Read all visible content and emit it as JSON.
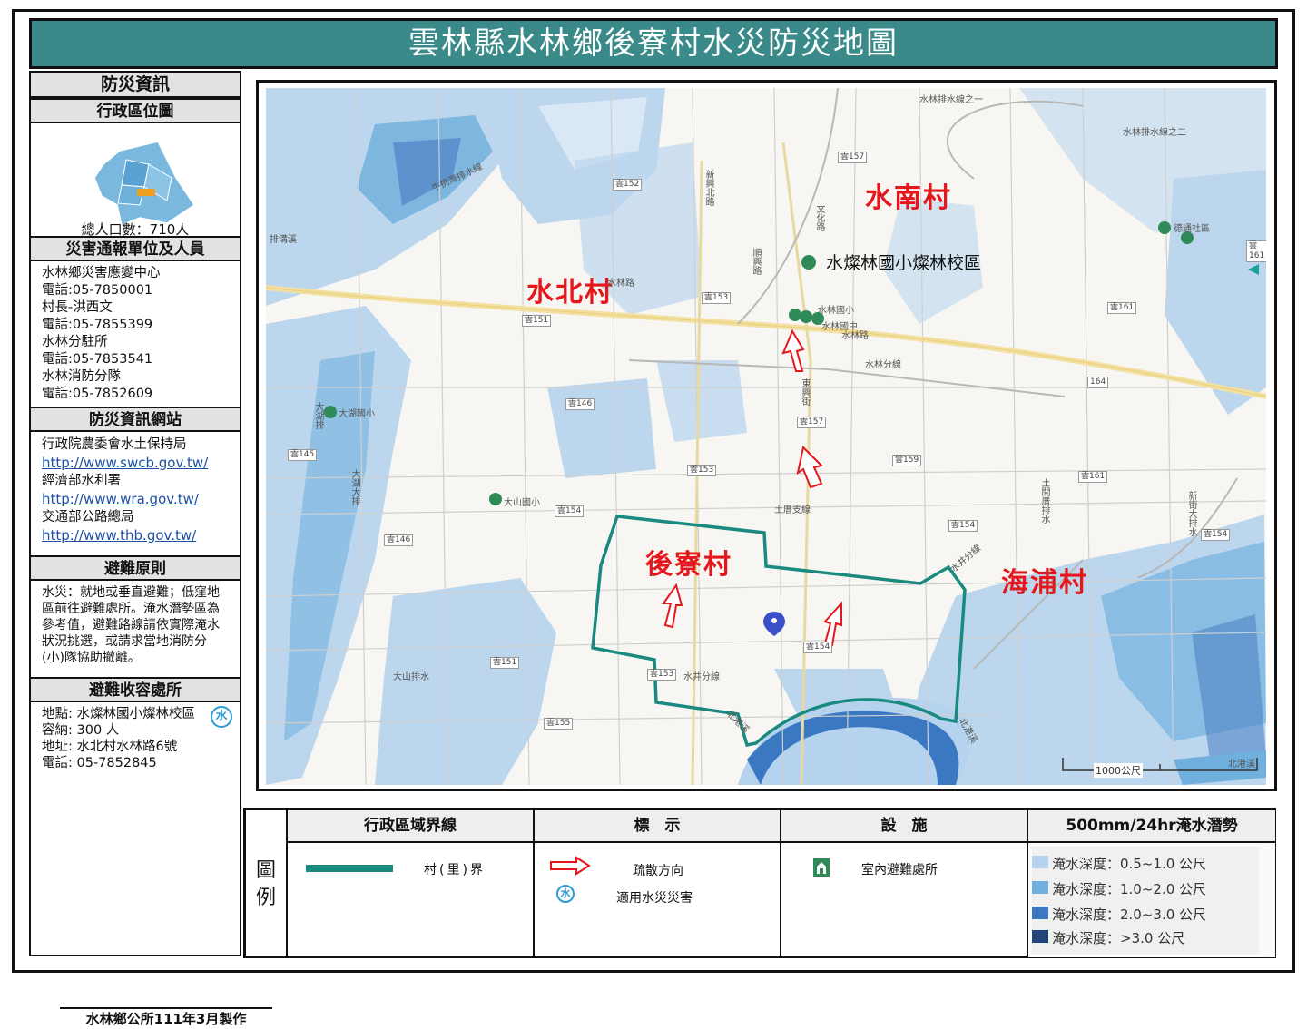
{
  "title": "雲林縣水林鄉後寮村水災防災地圖",
  "sidebar": {
    "info_header": "防災資訊",
    "location_header": "行政區位圖",
    "population": "總人口數：710人",
    "contacts_header": "災害通報單位及人員",
    "contacts": [
      "水林鄉災害應變中心",
      "電話:05-7850001",
      "村長-洪西文",
      "電話:05-7855399",
      "水林分駐所",
      "電話:05-7853541",
      "水林消防分隊",
      "電話:05-7852609"
    ],
    "websites_header": "防災資訊網站",
    "sites": [
      {
        "name": "行政院農委會水土保持局",
        "url": "http://www.swcb.gov.tw/"
      },
      {
        "name": "經濟部水利署",
        "url": "http://www.wra.gov.tw/"
      },
      {
        "name": "交通部公路總局",
        "url": "http://www.thb.gov.tw/"
      }
    ],
    "principle_header": "避難原則",
    "principle_text": "水災：就地或垂直避難；低窪地區前往避難處所。淹水潛勢區為參考值，避難路線請依實際淹水狀況挑選，或請求當地消防分(小)隊協助撤離。",
    "shelter_header": "避難收容處所",
    "shelter": {
      "location": "地點: 水燦林國小燦林校區",
      "capacity": "容納: 300 人",
      "address": "地址: 水北村水林路6號",
      "phone": "電話: 05-7852845",
      "badge": "水"
    },
    "footer": "水林鄉公所111年3月製作"
  },
  "map": {
    "villages": [
      "水南村",
      "水北村",
      "後寮村",
      "海浦村"
    ],
    "school_label": "水燦林國小燦林校區",
    "scale_label": "1000公尺",
    "roads": [
      "雲157",
      "雲152",
      "雲153",
      "雲151",
      "雲146",
      "雲145",
      "雲157",
      "雲159",
      "雲161",
      "雲153",
      "雲154",
      "雲154",
      "雲146",
      "雲151",
      "雲153",
      "雲154",
      "雲155",
      "雲161",
      "雲154",
      "164",
      "雲161"
    ],
    "road_names": [
      "水林排水線之一",
      "水林排水線之二",
      "牛挑灣排水線",
      "新興北路",
      "文化路",
      "順興路",
      "水林路",
      "水林路",
      "水林分線",
      "東興街",
      "土厝支線",
      "水井分線",
      "水井分線",
      "大湖大排",
      "大湖排",
      "土間厝排水",
      "新街大排水",
      "北港溪",
      "北港溪",
      "大山排水",
      "排溝溪",
      "水林國小",
      "水林國中",
      "大湖國小",
      "大山國小",
      "德通社區",
      "北港溪"
    ]
  },
  "legend": {
    "side_label": [
      "圖",
      "例"
    ],
    "boundary_header": "行政區域界線",
    "boundary_item": "村(里)界",
    "marker_header": "標　示",
    "evac_item": "疏散方向",
    "flood_item": "適用水災災害",
    "flood_badge": "水",
    "facility_header": "設　施",
    "shelter_item": "室內避難處所",
    "depth_header": "500mm/24hr淹水潛勢",
    "depths": [
      {
        "label": "淹水深度：0.5~1.0 公尺",
        "color": "#b5d3ee"
      },
      {
        "label": "淹水深度：1.0~2.0 公尺",
        "color": "#6fb0de"
      },
      {
        "label": "淹水深度：2.0~3.0 公尺",
        "color": "#3a78c2"
      },
      {
        "label": "淹水深度：>3.0 公尺",
        "color": "#22427a"
      }
    ]
  },
  "colors": {
    "title_bg": "#3a8a8a",
    "boundary": "#1a8a80",
    "village_text": "#e4181c",
    "evac_arrow": "#e4181c"
  }
}
